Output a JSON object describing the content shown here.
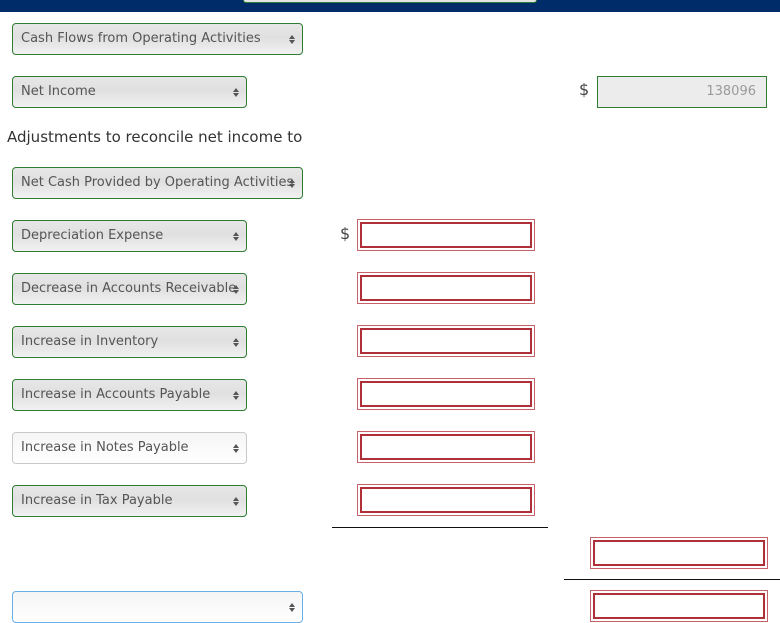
{
  "header": {
    "top_select_value": ""
  },
  "rows": {
    "section_heading_select": "Cash Flows from Operating Activities",
    "net_income_select": "Net Income",
    "net_income_currency": "$",
    "net_income_value": "138096",
    "adjustments_label": "Adjustments to reconcile net income to",
    "operating_select": "Net Cash Provided by Operating Activities"
  },
  "adjustments": [
    {
      "select": "Depreciation Expense",
      "currency": "$",
      "value": ""
    },
    {
      "select": "Decrease in Accounts Receivable",
      "currency": "",
      "value": ""
    },
    {
      "select": "Increase in Inventory",
      "currency": "",
      "value": ""
    },
    {
      "select": "Increase in Accounts Payable",
      "currency": "",
      "value": ""
    },
    {
      "select": "Increase in Notes Payable",
      "currency": "",
      "value": ""
    },
    {
      "select": "Increase in Tax Payable",
      "currency": "",
      "value": ""
    }
  ],
  "totals": {
    "adjustments_total_value": "",
    "bottom_select_value": "",
    "bottom_total_value": ""
  },
  "colors": {
    "topbar": "#002d69",
    "select_border": "#2e7d32",
    "input_error_border": "#b0303a",
    "focus_border": "#6aaee8"
  }
}
